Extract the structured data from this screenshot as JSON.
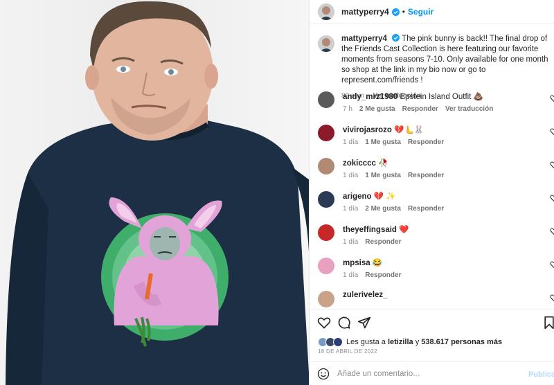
{
  "post": {
    "username": "mattyperry4",
    "follow_label": "Seguir",
    "separator": "•",
    "caption": "The pink bunny is back!! The final drop of the Friends Cast Collection is here featuring our favorite moments from seasons 7-10. Only available for one month so shop at the link in my bio now or go to represent.com/friends !",
    "caption_age": "80 sem",
    "caption_translate": "Ver traducción"
  },
  "comments": [
    {
      "user": "andy_mrz1980",
      "text": "Epstein Island Outfit 💩",
      "age": "7 h",
      "likes": "2 Me gusta",
      "reply": "Responder",
      "translate": "Ver traducción",
      "avatar_color": "#5a5a5a"
    },
    {
      "user": "vivirojasrozo",
      "text": "💔🫷🐰",
      "age": "1 día",
      "likes": "1 Me gusta",
      "reply": "Responder",
      "translate": "",
      "avatar_color": "#8b1a2b"
    },
    {
      "user": "zokicccc",
      "text": "🥀",
      "age": "1 día",
      "likes": "1 Me gusta",
      "reply": "Responder",
      "translate": "",
      "avatar_color": "#b08a72"
    },
    {
      "user": "arigeno",
      "text": "💔 ✨",
      "age": "1 día",
      "likes": "2 Me gusta",
      "reply": "Responder",
      "translate": "",
      "avatar_color": "#2b3a55"
    },
    {
      "user": "theyeffingsaid",
      "text": "❤️",
      "age": "1 día",
      "likes": "",
      "reply": "Responder",
      "translate": "",
      "avatar_color": "#c62828"
    },
    {
      "user": "mpsisa",
      "text": "😂",
      "age": "1 día",
      "likes": "",
      "reply": "Responder",
      "translate": "",
      "avatar_color": "#e8a0c0"
    },
    {
      "user": "zulerivelez_",
      "text": "",
      "age": "",
      "likes": "",
      "reply": "",
      "translate": "",
      "avatar_color": "#c9a28a"
    }
  ],
  "likes": {
    "prefix": "Les gusta a",
    "user": "letizilla",
    "connector": "y",
    "count": "538.617 personas más"
  },
  "date": "18 DE ABRIL DE 2022",
  "composer": {
    "placeholder": "Añade un comentario...",
    "publish_label": "Publicar"
  },
  "icons": {
    "like": "heart-icon",
    "comment": "comment-icon",
    "share": "paper-plane-icon",
    "save": "bookmark-icon",
    "emoji": "smiley-icon",
    "verified": "verified-badge-icon"
  },
  "colors": {
    "follow": "#0095f6",
    "verified": "#1da1f2",
    "muted": "#8e8e8e",
    "publish_disabled": "#b3dbff",
    "shirt": "#1d2f45",
    "bunny_pink": "#e2a4d8",
    "circle_green": "#3fae6b"
  }
}
